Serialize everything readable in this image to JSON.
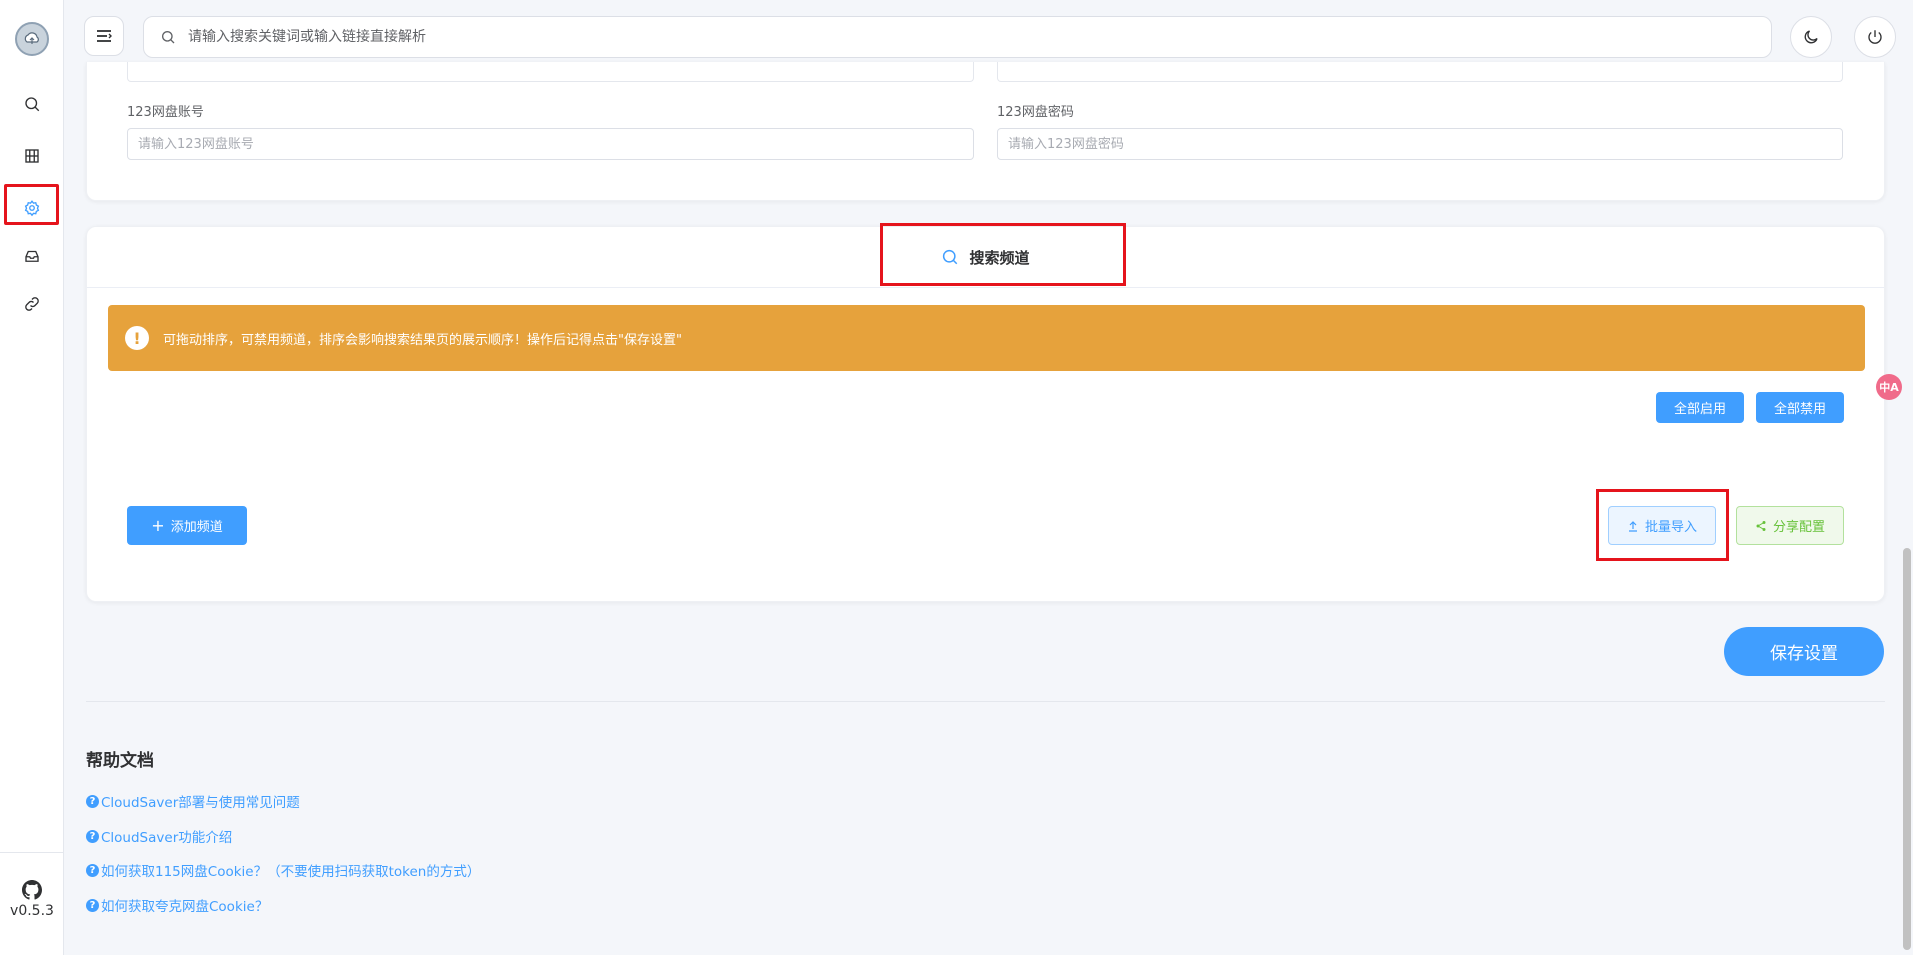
{
  "search": {
    "placeholder": "请输入搜索关键词或输入链接直接解析"
  },
  "sidebar": {
    "items": [
      {
        "name": "search"
      },
      {
        "name": "movies"
      },
      {
        "name": "settings",
        "active": true
      },
      {
        "name": "inbox"
      },
      {
        "name": "links"
      }
    ],
    "version": "v0.5.3"
  },
  "pan123": {
    "account_label": "123网盘账号",
    "account_placeholder": "请输入123网盘账号",
    "password_label": "123网盘密码",
    "password_placeholder": "请输入123网盘密码"
  },
  "channels": {
    "title": "搜索频道",
    "alert": "可拖动排序，可禁用频道，排序会影响搜索结果页的展示顺序！操作后记得点击\"保存设置\"",
    "enable_all": "全部启用",
    "disable_all": "全部禁用",
    "add": "添加频道",
    "import": "批量导入",
    "share": "分享配置"
  },
  "save_label": "保存设置",
  "help": {
    "title": "帮助文档",
    "links": [
      "CloudSaver部署与使用常见问题",
      "CloudSaver功能介绍",
      "如何获取115网盘Cookie？（不要使用扫码获取token的方式）",
      "如何获取夸克网盘Cookie？"
    ]
  },
  "translate_badge": "中A",
  "colors": {
    "primary": "#409eff",
    "warning": "#e6a23c",
    "success": "#67c23a",
    "highlight": "#e5141c"
  }
}
